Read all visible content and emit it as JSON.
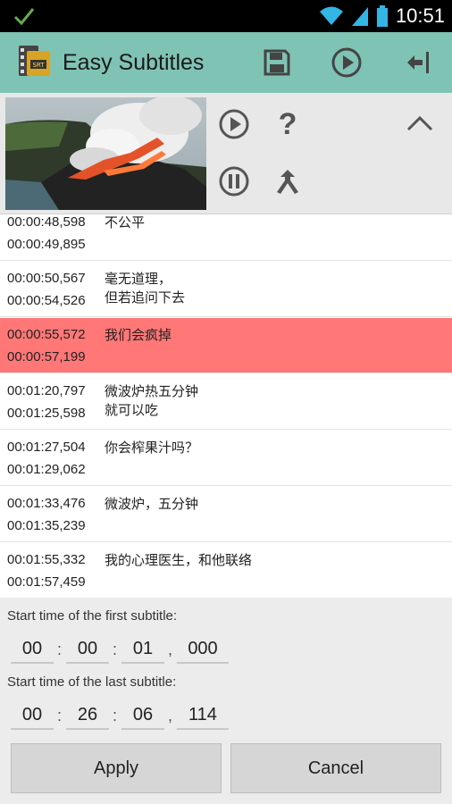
{
  "status_bar": {
    "time": "10:51",
    "icons": [
      "check-icon",
      "wifi-icon",
      "signal-icon",
      "battery-icon"
    ]
  },
  "app": {
    "title": "Easy Subtitles",
    "accent_color": "#7fc3b4",
    "selected_row_color": "#ff7777",
    "actions": [
      "save-icon",
      "play-circle-icon",
      "exit-icon"
    ]
  },
  "video": {
    "controls": [
      "play-icon",
      "help-icon",
      "collapse-icon",
      "pause-icon",
      "merge-icon"
    ],
    "help_glyph": "?"
  },
  "subtitles": [
    {
      "start": "00:00:48,598",
      "end": "00:00:49,895",
      "text": "不公平",
      "selected": false
    },
    {
      "start": "00:00:50,567",
      "end": "00:00:54,526",
      "text": "毫无道理，\n但若追问下去",
      "selected": false
    },
    {
      "start": "00:00:55,572",
      "end": "00:00:57,199",
      "text": "我们会疯掉",
      "selected": true
    },
    {
      "start": "00:01:20,797",
      "end": "00:01:25,598",
      "text": "微波炉热五分钟\n就可以吃",
      "selected": false
    },
    {
      "start": "00:01:27,504",
      "end": "00:01:29,062",
      "text": "你会榨果汁吗？",
      "selected": false
    },
    {
      "start": "00:01:33,476",
      "end": "00:01:35,239",
      "text": "微波炉，五分钟",
      "selected": false
    },
    {
      "start": "00:01:55,332",
      "end": "00:01:57,459",
      "text": "我的心理医生，和他联络",
      "selected": false
    }
  ],
  "first_subtitle": {
    "label": "Start time of the first subtitle:",
    "hh": "00",
    "mm": "00",
    "ss": "01",
    "ms": "000"
  },
  "last_subtitle": {
    "label": "Start time of the last subtitle:",
    "hh": "00",
    "mm": "26",
    "ss": "06",
    "ms": "114"
  },
  "separators": {
    "colon": ":",
    "comma": ","
  },
  "buttons": {
    "apply": "Apply",
    "cancel": "Cancel"
  }
}
